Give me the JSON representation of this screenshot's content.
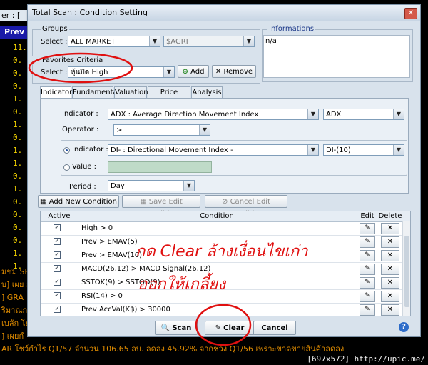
{
  "background": {
    "tab_label": "er : [ AL",
    "prev_label": "Prev",
    "numbers": [
      "11.",
      "0.",
      "0.",
      "0.",
      "1.",
      "0.",
      "1.",
      "0.",
      "1.",
      "1.",
      "0.",
      "1.",
      "0.",
      "0.",
      "0.",
      "0.",
      "1.",
      "1."
    ],
    "text_lines": [
      "มชม SE",
      "บ] เผย ก",
      "] GRA",
      "ริมาณก",
      "เบลัก โย",
      "] เผยกํ",
      "AR โชว์กำไร Q1/57 จำนวน 106.65 ลบ. ลดลง 45.92% จากช่วง Q1/56 เพราะขาดขายสินค้าลดลง"
    ]
  },
  "watermark": "[697x572] http://upic.me/",
  "dialog": {
    "title": "Total Scan : Condition Setting",
    "close_icon": "close-icon",
    "groups_label": "Groups",
    "select_label": "Select :",
    "group_value": "ALL MARKET",
    "subgroup_value": "$AGRI",
    "informations_label": "Informations",
    "informations_value": "n/a",
    "favorites_label": "Favorites Criteria",
    "favorites_select_label": "Select :",
    "favorites_value": "หุ้นปิด High",
    "add_button": "Add",
    "remove_button": "Remove",
    "tabs": [
      "Indicator",
      "Fundamental",
      "Valuation",
      "Price Pattern",
      "Analysis"
    ],
    "indicator_label": "Indicator :",
    "indicator_value": "ADX : Average Direction Movement Index",
    "indicator_param": "ADX",
    "operator_label": "Operator :",
    "operator_value": ">",
    "compare_indicator_label": "Indicator :",
    "compare_indicator_value": "DI- : Directional Movement Index -",
    "compare_indicator_param": "DI-(10)",
    "value_label": "Value :",
    "period_label": "Period :",
    "period_value": "Day",
    "add_condition_button": "Add New Condition",
    "save_edit_button": "Save Edit Condition",
    "cancel_edit_button": "Cancel Edit Condition",
    "grid_headers": {
      "active": "Active",
      "condition": "Condition",
      "edit": "Edit",
      "delete": "Delete"
    },
    "conditions": [
      {
        "text": "High > 0",
        "active": true
      },
      {
        "text": "Prev > EMAV(5)",
        "active": true
      },
      {
        "text": "Prev > EMAV(10)",
        "active": true
      },
      {
        "text": "MACD(26,12) > MACD Signal(26,12)",
        "active": true
      },
      {
        "text": "SSTOK(9) > SSTOD(9)",
        "active": true
      },
      {
        "text": "RSI(14) > 0",
        "active": true
      },
      {
        "text": "Prev AccVal(K฿) > 30000",
        "active": true
      }
    ],
    "scan_button": "Scan",
    "clear_button": "Clear",
    "cancel_button": "Cancel",
    "help_icon": "help-icon"
  },
  "annotation": {
    "line1": "กด Clear ล้างเงื่อนไขเก่า",
    "line2": "ออกให้เกลี้ยง",
    "color": "#e01010"
  }
}
